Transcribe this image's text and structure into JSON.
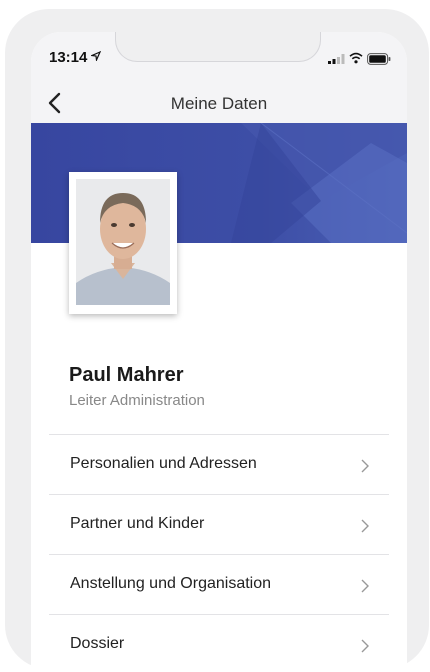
{
  "status": {
    "time": "13:14"
  },
  "nav": {
    "title": "Meine Daten"
  },
  "profile": {
    "name": "Paul Mahrer",
    "role": "Leiter Administration"
  },
  "menu": [
    {
      "label": "Personalien und Adressen"
    },
    {
      "label": "Partner und Kinder"
    },
    {
      "label": "Anstellung und Organisation"
    },
    {
      "label": "Dossier"
    }
  ],
  "colors": {
    "accent": "#3a4aa0",
    "background": "#ffffff",
    "navbar": "#f4f4f6"
  }
}
